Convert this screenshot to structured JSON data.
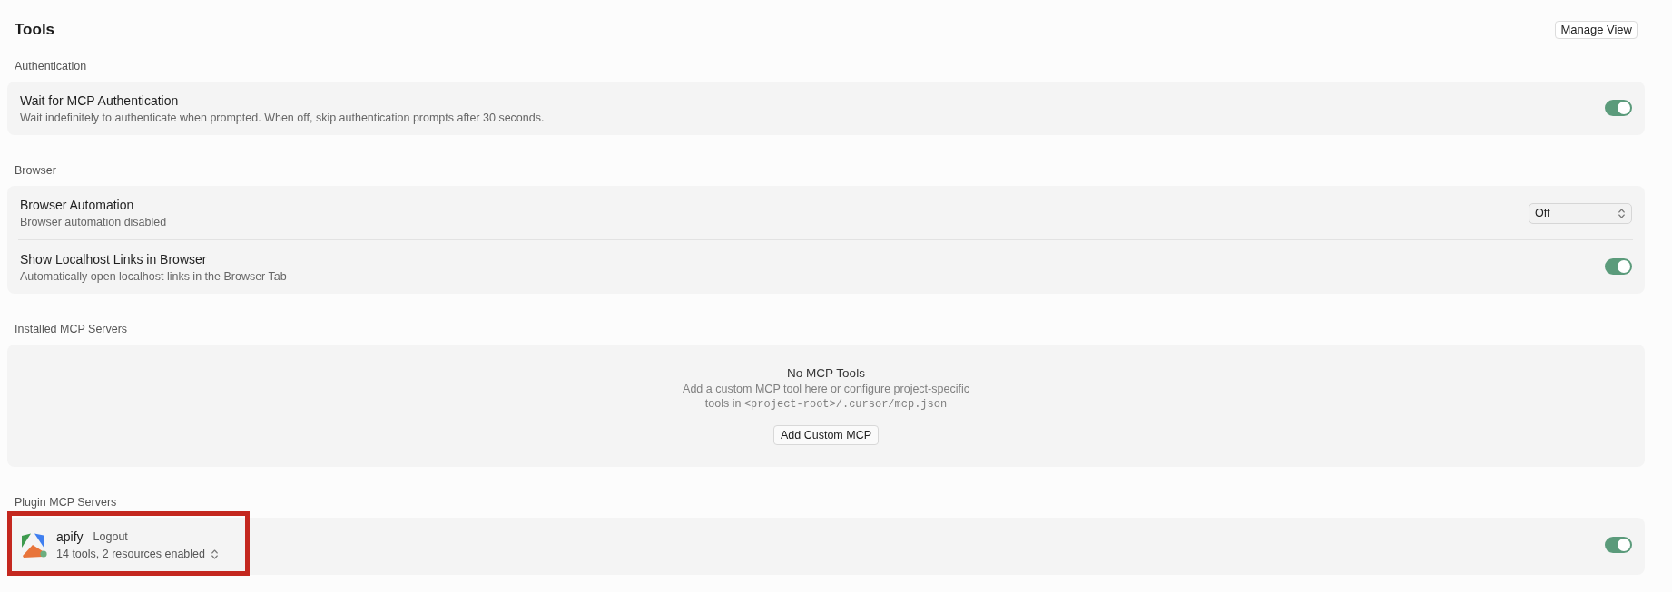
{
  "header": {
    "title": "Tools",
    "button": "Manage View"
  },
  "sections": [
    {
      "label": "Authentication",
      "kind": "settings",
      "rows": [
        {
          "kind": "toggle",
          "title": "Wait for MCP Authentication",
          "description": "Wait indefinitely to authenticate when prompted. When off, skip authentication prompts after 30 seconds.",
          "on": true
        }
      ]
    },
    {
      "label": "Browser",
      "kind": "settings",
      "rows": [
        {
          "kind": "select",
          "title": "Browser Automation",
          "description": "Browser automation disabled",
          "value": "Off"
        },
        {
          "kind": "toggle",
          "title": "Show Localhost Links in Browser",
          "description": "Automatically open localhost links in the Browser Tab",
          "on": true
        }
      ]
    },
    {
      "label": "Installed MCP Servers",
      "kind": "empty",
      "empty_state": {
        "title": "No MCP Tools",
        "description": "Add a custom MCP tool here or configure project-specific tools in",
        "path": "<project-root>/.cursor/mcp.json",
        "button": "Add Custom MCP"
      }
    },
    {
      "label": "Plugin MCP Servers",
      "kind": "servers",
      "servers": [
        {
          "name": "apify",
          "action": "Logout",
          "summary": "14 tools, 2 resources enabled",
          "connected": true,
          "on": true,
          "highlighted": true
        }
      ]
    }
  ]
}
